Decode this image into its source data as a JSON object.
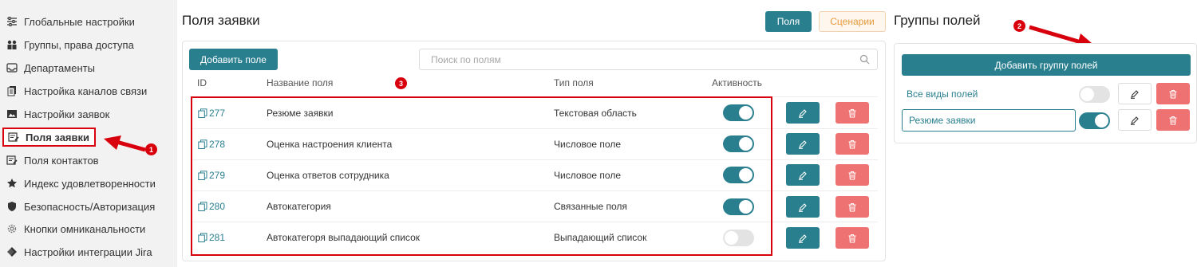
{
  "sidebar": {
    "items": [
      {
        "label": "Глобальные настройки",
        "icon": "sliders-icon"
      },
      {
        "label": "Группы, права доступа",
        "icon": "users-icon"
      },
      {
        "label": "Департаменты",
        "icon": "inbox-icon"
      },
      {
        "label": "Настройка каналов связи",
        "icon": "copy-icon"
      },
      {
        "label": "Настройки заявок",
        "icon": "image-icon"
      },
      {
        "label": "Поля заявки",
        "icon": "edit-list-icon",
        "active": true
      },
      {
        "label": "Поля контактов",
        "icon": "edit-list-icon"
      },
      {
        "label": "Индекс удовлетворенности",
        "icon": "star-icon"
      },
      {
        "label": "Безопасность/Авторизация",
        "icon": "shield-icon"
      },
      {
        "label": "Кнопки омниканальности",
        "icon": "gear-icon"
      },
      {
        "label": "Настройки интеграции Jira",
        "icon": "jira-icon"
      }
    ]
  },
  "main": {
    "title": "Поля заявки",
    "tabs": {
      "fields": "Поля",
      "scenarios": "Сценарии"
    },
    "add_field_label": "Добавить поле",
    "search": {
      "placeholder": "Поиск по полям",
      "value": ""
    },
    "columns": {
      "id": "ID",
      "name": "Название поля",
      "type": "Тип поля",
      "active": "Активность"
    },
    "rows": [
      {
        "id": "277",
        "name": "Резюме заявки",
        "type": "Текстовая область",
        "active": true
      },
      {
        "id": "278",
        "name": "Оценка настроения клиента",
        "type": "Числовое поле",
        "active": true
      },
      {
        "id": "279",
        "name": "Оценка ответов сотрудника",
        "type": "Числовое поле",
        "active": true
      },
      {
        "id": "280",
        "name": "Автокатегория",
        "type": "Связанные поля",
        "active": true
      },
      {
        "id": "281",
        "name": "Автокатегоря выпадающий список",
        "type": "Выпадающий список",
        "active": false
      }
    ]
  },
  "groups": {
    "title": "Группы полей",
    "add_label": "Добавить группу полей",
    "items": [
      {
        "label": "Все виды полей",
        "active": false
      },
      {
        "label": "Резюме заявки",
        "active": true
      }
    ]
  },
  "annotations": {
    "badge1": "1",
    "badge2": "2",
    "badge3": "3"
  },
  "colors": {
    "accent": "#2a7f8f",
    "danger": "#ef7272",
    "annotation": "#d8000c"
  }
}
